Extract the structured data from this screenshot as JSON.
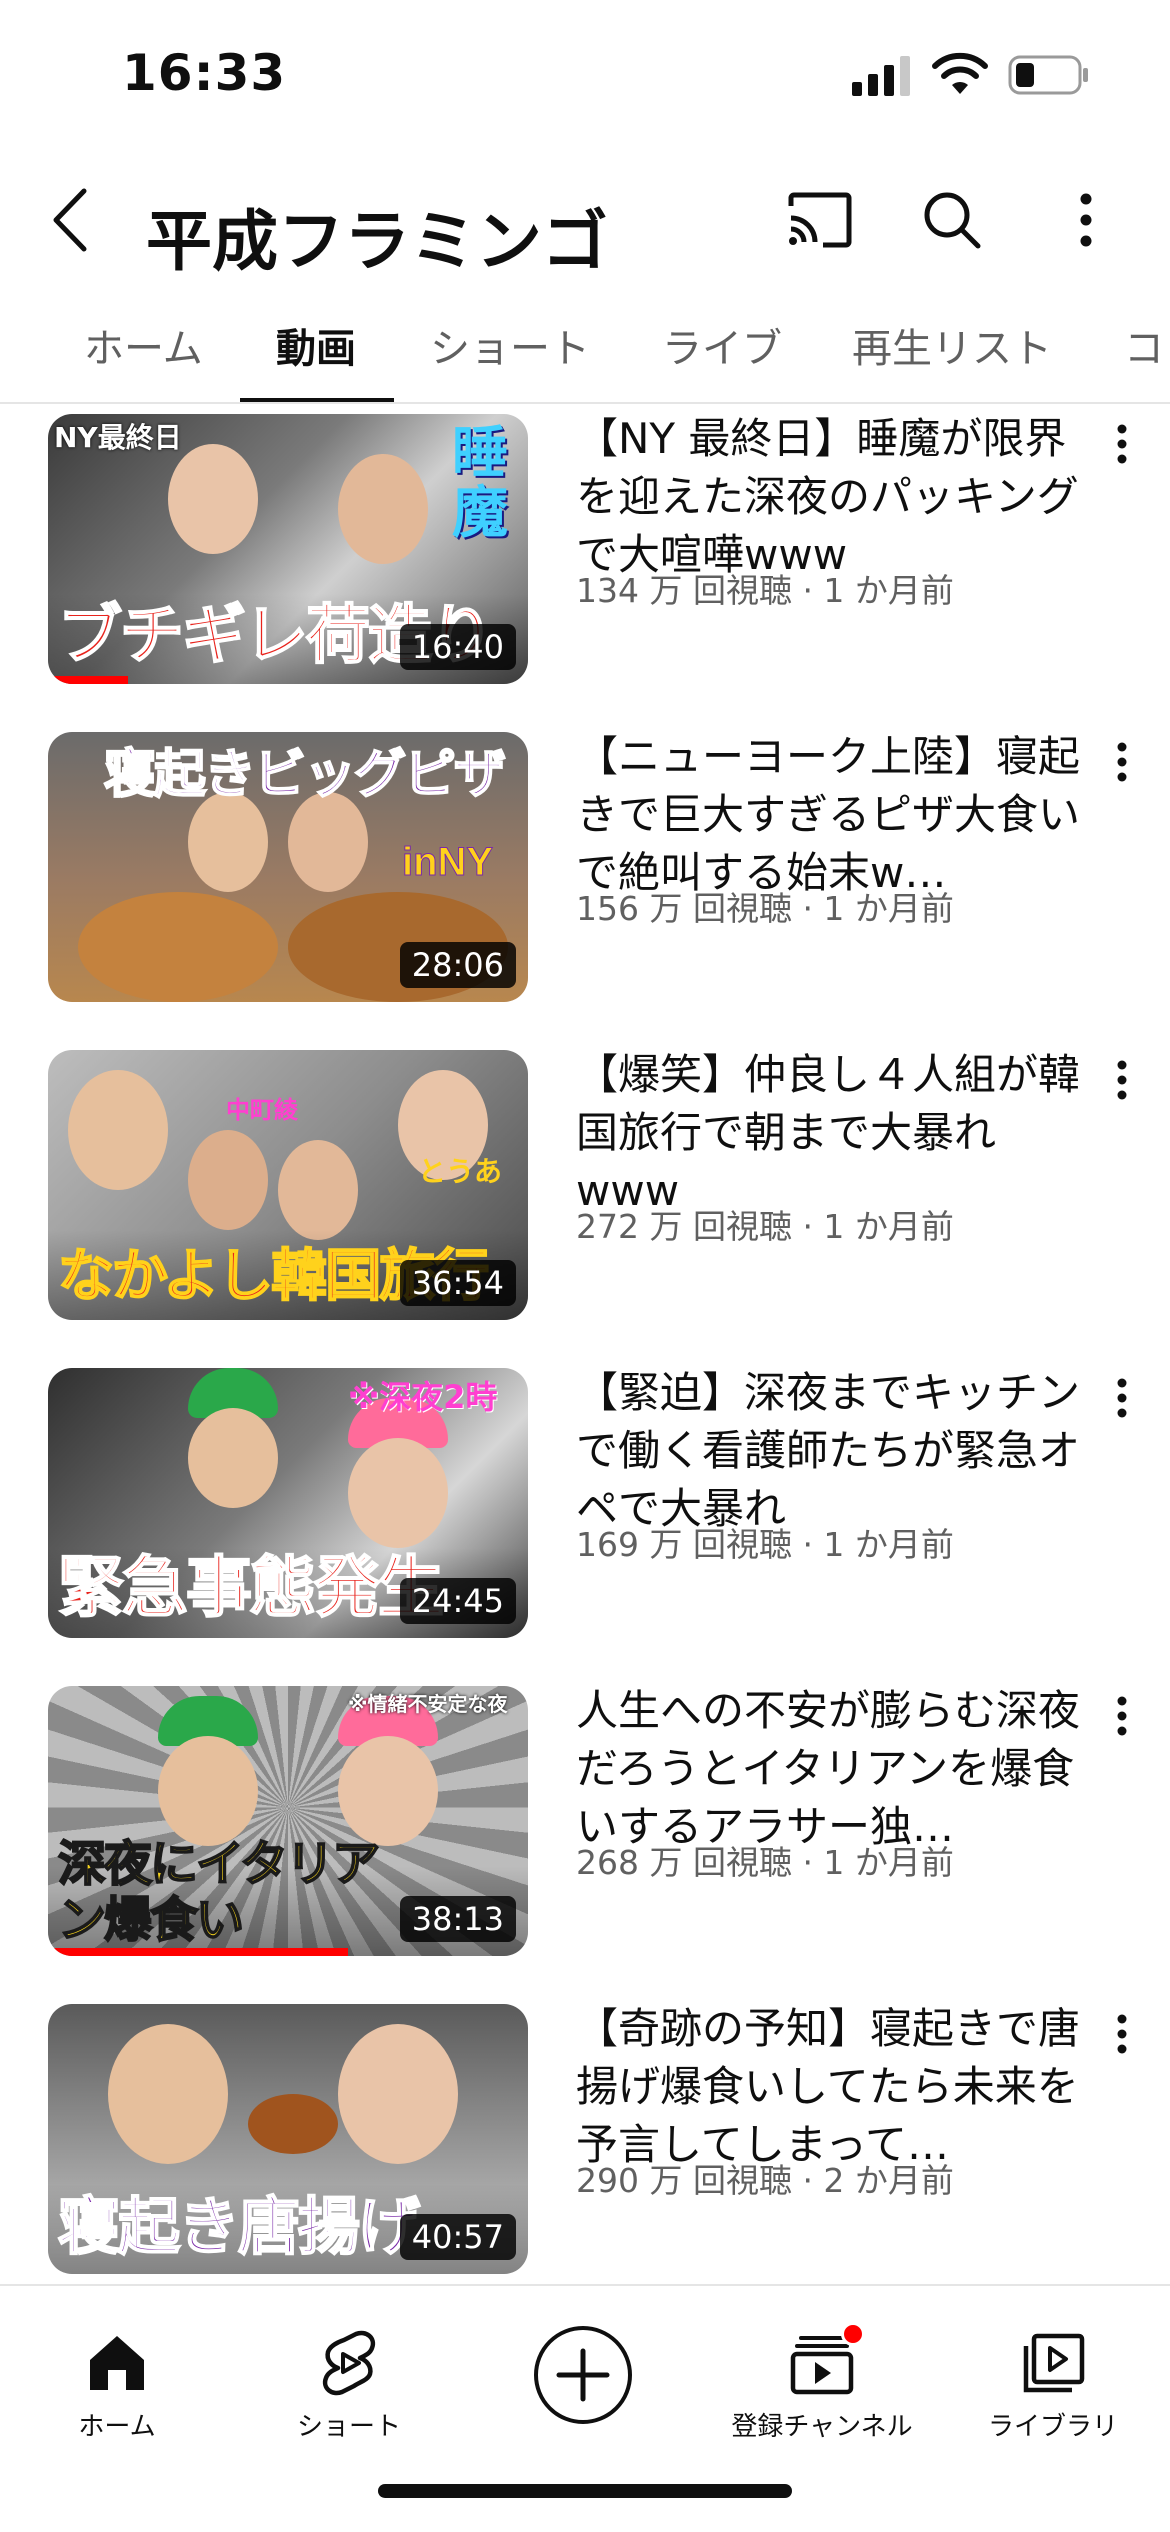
{
  "status_bar": {
    "time": "16:33"
  },
  "header": {
    "channel_title": "平成フラミンゴ",
    "back_icon": "chevron-left-icon",
    "cast_icon": "cast-icon",
    "search_icon": "search-icon",
    "more_icon": "more-vertical-icon"
  },
  "tabs": [
    {
      "label": "ホーム"
    },
    {
      "label": "動画",
      "active": true
    },
    {
      "label": "ショート"
    },
    {
      "label": "ライブ"
    },
    {
      "label": "再生リスト"
    },
    {
      "label": "コミ"
    }
  ],
  "videos": [
    {
      "title": "【NY 最終日】睡魔が限界を迎えた深夜のパッキングで大喧嘩www",
      "meta": "134 万 回視聴 · 1 か月前",
      "duration": "16:40",
      "thumb_text": "ブチギレ荷造り",
      "thumb_tags": [
        "NY最終日",
        "睡魔"
      ],
      "thumb_colors": {
        "bg": "#6b6b6b",
        "text": "#e8231c"
      }
    },
    {
      "title": "【ニューヨーク上陸】寝起きで巨大すぎるピザ大食いで絶叫する始末w…",
      "meta": "156 万 回視聴 · 1 か月前",
      "duration": "28:06",
      "thumb_text": "寝起きビッグピザ",
      "thumb_tags": [
        "inNY"
      ],
      "thumb_colors": {
        "bg": "#8a6a55",
        "text": "#7a2aa8"
      }
    },
    {
      "title": "【爆笑】仲良し４人組が韓国旅行で朝まで大暴れwww",
      "meta": "272 万 回視聴 · 1 か月前",
      "duration": "36:54",
      "thumb_text": "なかよし韓国旅行",
      "thumb_tags": [
        "中町綾",
        "とうあ"
      ],
      "thumb_colors": {
        "bg": "#9a9a9a",
        "text": "#e8231c"
      }
    },
    {
      "title": "【緊迫】深夜までキッチンで働く看護師たちが緊急オペで大暴れ",
      "meta": "169 万 回視聴 · 1 か月前",
      "duration": "24:45",
      "thumb_text": "緊急事態発生",
      "thumb_tags": [
        "※深夜2時"
      ],
      "thumb_colors": {
        "bg": "#555555",
        "text": "#e8231c"
      }
    },
    {
      "title": "人生への不安が膨らむ深夜だろうとイタリアンを爆食いするアラサー独…",
      "meta": "268 万 回視聴 · 1 か月前",
      "duration": "38:13",
      "thumb_text": "深夜にイタリアン爆食い",
      "thumb_tags": [
        "※情緒不安定な夜"
      ],
      "thumb_colors": {
        "bg": "#777777",
        "text": "#f5d21c"
      }
    },
    {
      "title": "【奇跡の予知】寝起きで唐揚げ爆食いしてたら未来を予言してしまって…",
      "meta": "290 万 回視聴 · 2 か月前",
      "duration": "40:57",
      "thumb_text": "寝起き唐揚げ",
      "thumb_tags": [],
      "thumb_colors": {
        "bg": "#8c8c8c",
        "text": "#7a2aa8"
      }
    }
  ],
  "bottom_nav": [
    {
      "label": "ホーム",
      "icon": "home-icon"
    },
    {
      "label": "ショート",
      "icon": "shorts-icon"
    },
    {
      "label": "",
      "icon": "create-plus-icon"
    },
    {
      "label": "登録チャンネル",
      "icon": "subscriptions-icon"
    },
    {
      "label": "ライブラリ",
      "icon": "library-icon"
    }
  ],
  "colors": {
    "accent_red": "#ff0000",
    "text_primary": "#0f0f0f",
    "text_secondary": "#606060"
  }
}
